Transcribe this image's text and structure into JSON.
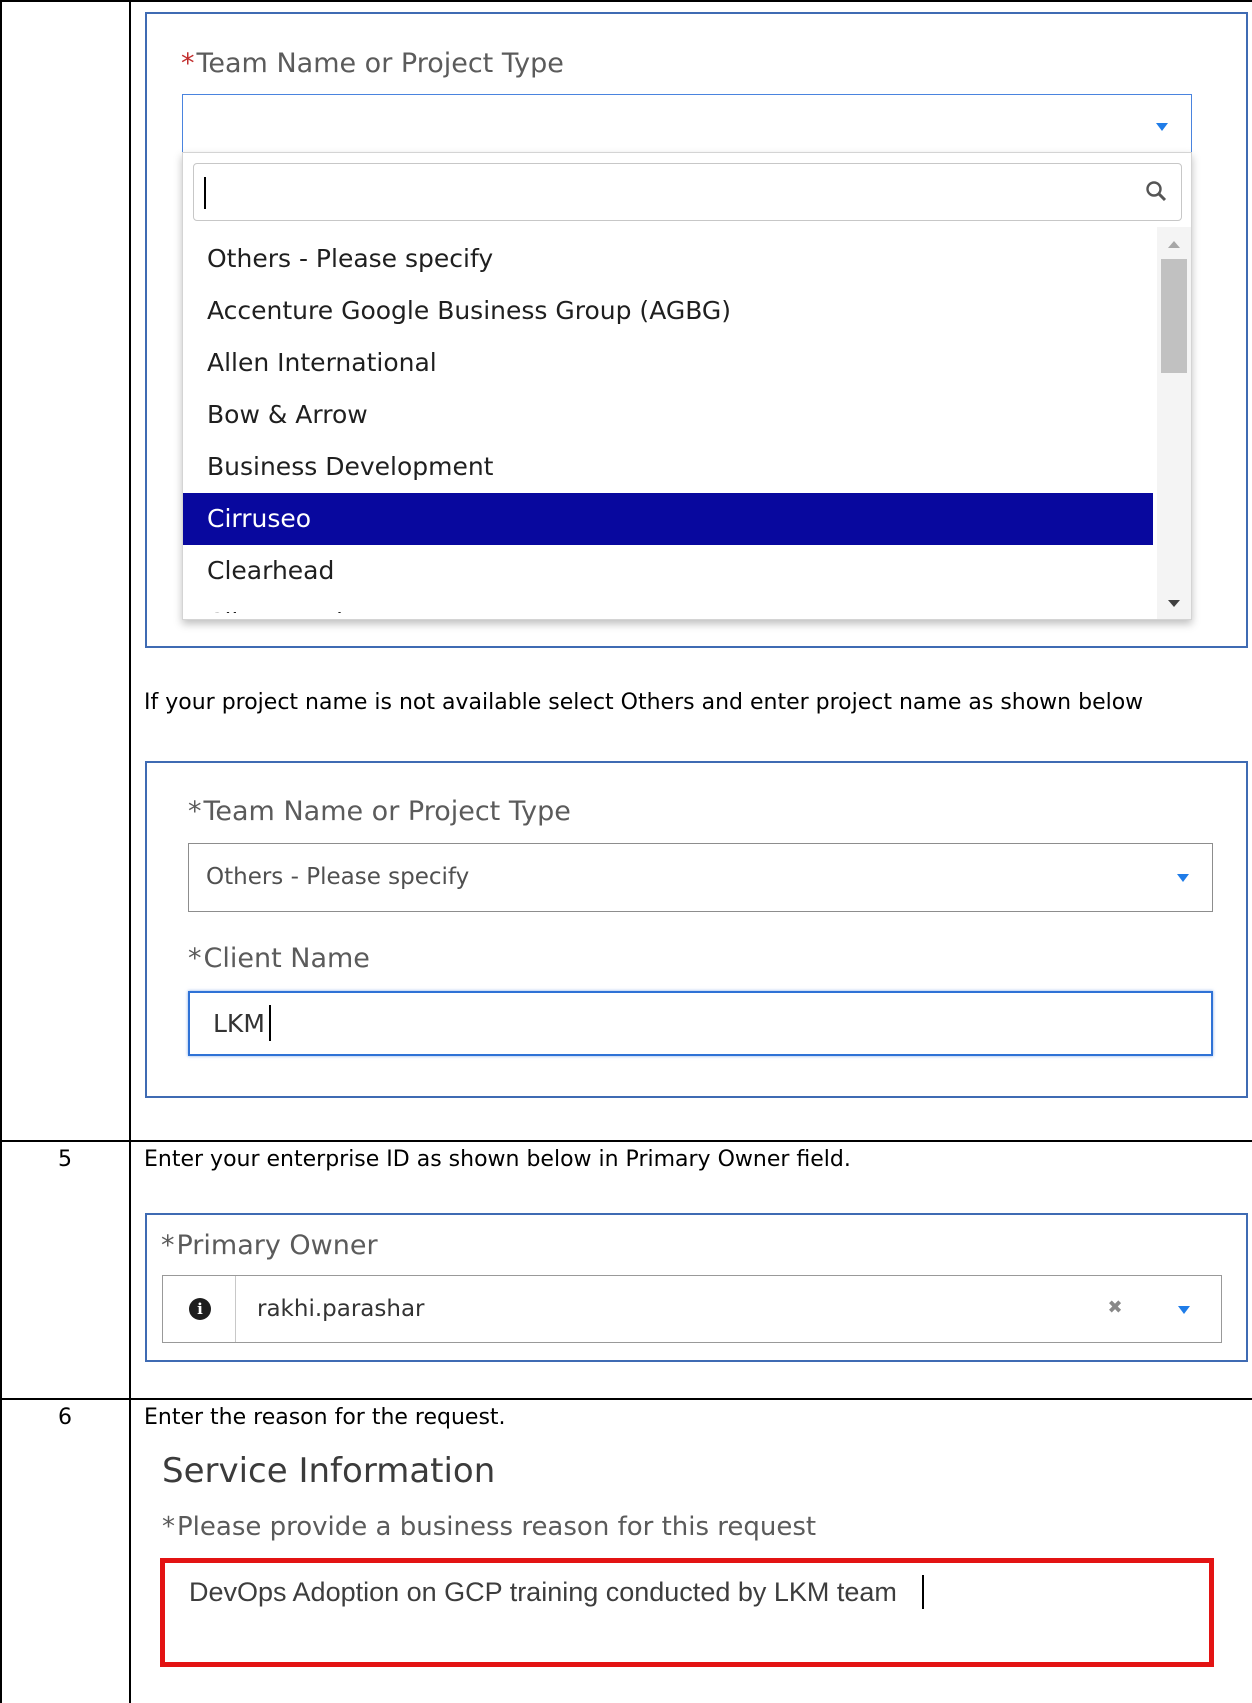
{
  "top_panel": {
    "required_mark": "*",
    "label": "Team Name or Project Type",
    "dropdown": {
      "search_value": "",
      "items": [
        "Others - Please specify",
        "Accenture Google Business Group (AGBG)",
        "Allen International",
        "Bow & Arrow",
        "Business Development",
        "Cirruseo",
        "Clearhead",
        "Client Work"
      ],
      "selected_item": "Cirruseo"
    }
  },
  "instruction_text": "If your project name is not available select Others and enter project name as shown below",
  "second_panel": {
    "required_mark_1": "*",
    "label_1": "Team Name or Project Type",
    "select_value": "Others - Please specify",
    "required_mark_2": "*",
    "label_2": "Client Name",
    "client_name_value": "LKM"
  },
  "step5": {
    "number": "5",
    "text": "Enter your enterprise ID as shown below in Primary Owner field.",
    "required_mark": "*",
    "label": "Primary Owner",
    "value": "rakhi.parashar",
    "icon": "info-icon",
    "clear_glyph": "✖"
  },
  "step6": {
    "number": "6",
    "text": "Enter the reason for the request.",
    "section_heading": "Service Information",
    "required_mark": "*",
    "label": "Please provide a business reason for this request",
    "value": "DevOps Adoption on GCP training conducted by LKM team"
  },
  "colors": {
    "panel_border": "#3f6bb3",
    "selected_item": "#08089e",
    "dropdown_caret": "#1f7ce8",
    "required_red": "#c12d2d",
    "focus_blue": "#2f72d6",
    "highlight_red": "#e31313"
  }
}
